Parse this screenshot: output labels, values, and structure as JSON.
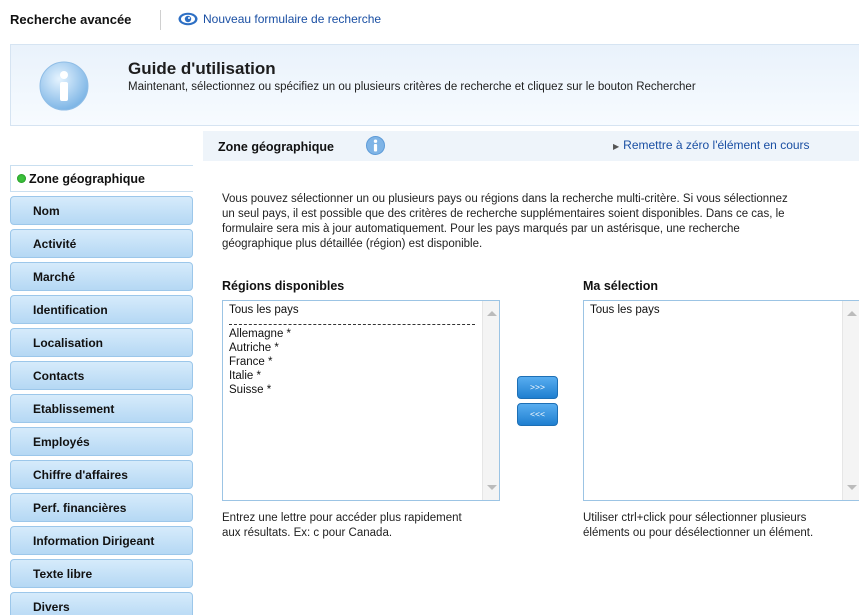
{
  "header": {
    "title": "Recherche avancée",
    "new_form_label": "Nouveau formulaire de recherche"
  },
  "guide": {
    "title": "Guide d'utilisation",
    "text": "Maintenant, sélectionnez ou spécifiez un ou plusieurs critères de recherche et cliquez sur le bouton Rechercher"
  },
  "sidebar": {
    "active": "Zone géographique",
    "items": [
      {
        "label": "Nom"
      },
      {
        "label": "Activité"
      },
      {
        "label": "Marché"
      },
      {
        "label": "Identification"
      },
      {
        "label": "Localisation"
      },
      {
        "label": "Contacts"
      },
      {
        "label": "Etablissement"
      },
      {
        "label": "Employés"
      },
      {
        "label": "Chiffre d'affaires"
      },
      {
        "label": "Perf. financières"
      },
      {
        "label": "Information Dirigeant"
      },
      {
        "label": "Texte libre"
      },
      {
        "label": "Divers"
      }
    ]
  },
  "section": {
    "title": "Zone géographique",
    "reset_label": "Remettre à zéro l'élément en cours",
    "description": [
      "Vous pouvez sélectionner un ou plusieurs pays ou régions dans la recherche multi-critère. Si vous sélectionnez",
      "un seul pays, il est possible que des critères de recherche supplémentaires soient disponibles. Dans ce cas, le",
      "formulaire sera mis à jour automatiquement. Pour les pays marqués par un astérisque, une recherche",
      "géographique plus détaillée (région) est disponible."
    ]
  },
  "available": {
    "label": "Régions disponibles",
    "first_item": "Tous les pays",
    "items": [
      "Allemagne *",
      "Autriche *",
      "France *",
      "Italie *",
      "Suisse *"
    ],
    "hint": [
      "Entrez une lettre pour accéder plus rapidement",
      "aux résultats. Ex: c pour Canada."
    ]
  },
  "selection": {
    "label": "Ma sélection",
    "items": [
      "Tous les pays"
    ],
    "hint": [
      "Utiliser ctrl+click pour sélectionner plusieurs",
      "éléments ou pour désélectionner un élément."
    ]
  },
  "buttons": {
    "add": ">>>",
    "remove": "<<<"
  },
  "colors": {
    "accent": "#1a4fa3",
    "button": "#2f8bdb",
    "sidebar_item": "#c6e1f7",
    "active_dot": "#3cc23c"
  }
}
